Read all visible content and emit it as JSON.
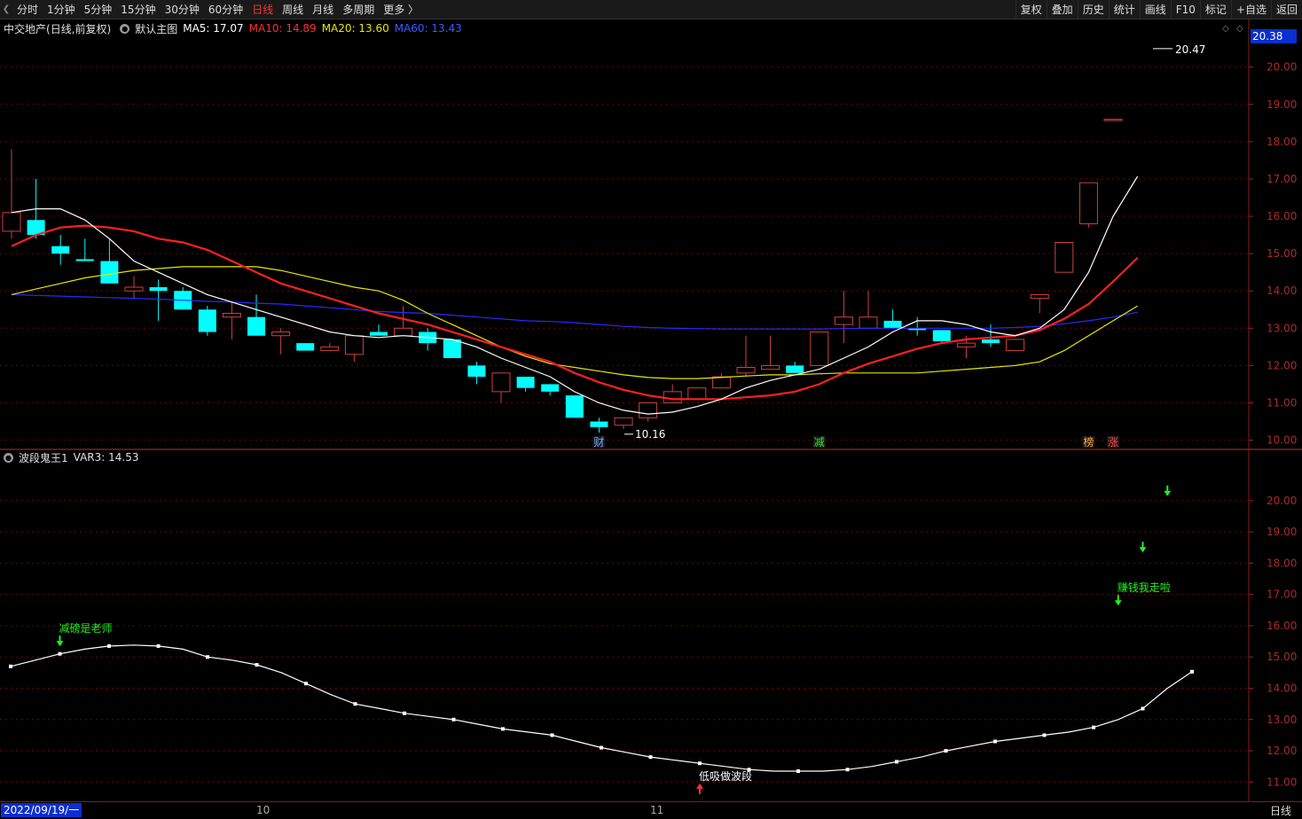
{
  "toolbar": {
    "tabs": [
      {
        "label": "分时",
        "active": false
      },
      {
        "label": "1分钟",
        "active": false
      },
      {
        "label": "5分钟",
        "active": false
      },
      {
        "label": "15分钟",
        "active": false
      },
      {
        "label": "30分钟",
        "active": false
      },
      {
        "label": "60分钟",
        "active": false
      },
      {
        "label": "日线",
        "active": true
      },
      {
        "label": "周线",
        "active": false
      },
      {
        "label": "月线",
        "active": false
      },
      {
        "label": "多周期",
        "active": false
      },
      {
        "label": "更多 〉",
        "active": false
      }
    ],
    "tools": [
      "复权",
      "叠加",
      "历史",
      "统计",
      "画线",
      "F10",
      "标记",
      "+自选",
      "返回"
    ]
  },
  "main_info": {
    "stock": "中交地产",
    "mode": "(日线,前复权)",
    "template": "默认主图",
    "ma5": "MA5: 17.07",
    "ma10": "MA10: 14.89",
    "ma20": "MA20: 13.60",
    "ma60": "MA60: 13.43",
    "current_price": "20.38",
    "high_label": "20.47",
    "low_label": "10.16"
  },
  "sub_info": {
    "indicator": "波段鬼王1",
    "var3": "VAR3: 14.53"
  },
  "bottom": {
    "date": "2022/09/19/一",
    "month_labels": [
      "10",
      "11"
    ],
    "period": "日线"
  },
  "colors": {
    "up": "#ff4040",
    "down": "#00ffff",
    "ma5": "#ffffff",
    "ma10": "#ff2020",
    "ma20": "#e8e800",
    "ma60": "#2a2aff",
    "grid": "#7a0000",
    "sig_text": "#22ee22"
  },
  "chart_data": [
    {
      "type": "candlestick",
      "y_ticks": [
        "20.00",
        "19.00",
        "18.00",
        "17.00",
        "16.00",
        "15.00",
        "14.00",
        "13.00",
        "12.00",
        "11.00",
        "10.00"
      ],
      "ylim": [
        9.8,
        20.8
      ],
      "candles": [
        {
          "o": 15.6,
          "c": 16.1,
          "h": 17.8,
          "l": 15.4
        },
        {
          "o": 15.9,
          "c": 15.5,
          "h": 17.0,
          "l": 15.4
        },
        {
          "o": 15.2,
          "c": 15.0,
          "h": 15.5,
          "l": 14.7
        },
        {
          "o": 14.85,
          "c": 14.8,
          "h": 15.4,
          "l": 14.8
        },
        {
          "o": 14.8,
          "c": 14.2,
          "h": 15.4,
          "l": 14.2
        },
        {
          "o": 14.0,
          "c": 14.1,
          "h": 14.4,
          "l": 13.8
        },
        {
          "o": 14.1,
          "c": 14.0,
          "h": 14.3,
          "l": 13.2
        },
        {
          "o": 14.0,
          "c": 13.5,
          "h": 14.1,
          "l": 13.5
        },
        {
          "o": 13.5,
          "c": 12.9,
          "h": 13.6,
          "l": 12.8
        },
        {
          "o": 13.3,
          "c": 13.4,
          "h": 13.7,
          "l": 12.7
        },
        {
          "o": 13.3,
          "c": 12.8,
          "h": 13.9,
          "l": 12.8
        },
        {
          "o": 12.8,
          "c": 12.9,
          "h": 13.0,
          "l": 12.3
        },
        {
          "o": 12.6,
          "c": 12.4,
          "h": 12.6,
          "l": 12.4
        },
        {
          "o": 12.4,
          "c": 12.5,
          "h": 12.6,
          "l": 12.4
        },
        {
          "o": 12.3,
          "c": 12.8,
          "h": 12.8,
          "l": 12.1
        },
        {
          "o": 12.9,
          "c": 12.8,
          "h": 13.1,
          "l": 12.8
        },
        {
          "o": 12.8,
          "c": 13.0,
          "h": 13.6,
          "l": 12.8
        },
        {
          "o": 12.9,
          "c": 12.6,
          "h": 13.0,
          "l": 12.4
        },
        {
          "o": 12.7,
          "c": 12.2,
          "h": 12.7,
          "l": 12.2
        },
        {
          "o": 12.0,
          "c": 11.7,
          "h": 12.1,
          "l": 11.5
        },
        {
          "o": 11.3,
          "c": 11.8,
          "h": 11.8,
          "l": 11.0
        },
        {
          "o": 11.7,
          "c": 11.4,
          "h": 11.7,
          "l": 11.3
        },
        {
          "o": 11.5,
          "c": 11.3,
          "h": 11.5,
          "l": 11.2
        },
        {
          "o": 11.2,
          "c": 10.6,
          "h": 11.2,
          "l": 10.6
        },
        {
          "o": 10.5,
          "c": 10.35,
          "h": 10.6,
          "l": 10.2
        },
        {
          "o": 10.4,
          "c": 10.6,
          "h": 10.6,
          "l": 10.3
        },
        {
          "o": 10.6,
          "c": 11.0,
          "h": 11.0,
          "l": 10.5
        },
        {
          "o": 11.0,
          "c": 11.3,
          "h": 11.5,
          "l": 11.0
        },
        {
          "o": 11.1,
          "c": 11.4,
          "h": 11.4,
          "l": 11.1
        },
        {
          "o": 11.4,
          "c": 11.7,
          "h": 11.8,
          "l": 11.4
        },
        {
          "o": 11.8,
          "c": 11.95,
          "h": 12.8,
          "l": 11.7
        },
        {
          "o": 11.9,
          "c": 12.0,
          "h": 12.8,
          "l": 11.9
        },
        {
          "o": 12.0,
          "c": 11.8,
          "h": 12.1,
          "l": 11.8
        },
        {
          "o": 12.0,
          "c": 12.9,
          "h": 12.9,
          "l": 12.0
        },
        {
          "o": 13.1,
          "c": 13.3,
          "h": 14.0,
          "l": 12.6
        },
        {
          "o": 13.0,
          "c": 13.3,
          "h": 14.0,
          "l": 13.0
        },
        {
          "o": 13.2,
          "c": 13.0,
          "h": 13.5,
          "l": 13.0
        },
        {
          "o": 13.0,
          "c": 12.95,
          "h": 13.3,
          "l": 12.8
        },
        {
          "o": 12.95,
          "c": 12.65,
          "h": 12.95,
          "l": 12.6
        },
        {
          "o": 12.5,
          "c": 12.6,
          "h": 12.8,
          "l": 12.2
        },
        {
          "o": 12.7,
          "c": 12.6,
          "h": 13.1,
          "l": 12.5
        },
        {
          "o": 12.4,
          "c": 12.7,
          "h": 12.7,
          "l": 12.4
        },
        {
          "o": 13.8,
          "c": 13.9,
          "h": 13.9,
          "l": 13.4
        },
        {
          "o": 14.5,
          "c": 15.3,
          "h": 15.3,
          "l": 14.5
        },
        {
          "o": 15.8,
          "c": 16.9,
          "h": 16.9,
          "l": 15.7
        },
        {
          "o": 18.6,
          "c": 18.6,
          "h": 18.6,
          "l": 18.6
        }
      ],
      "ma5": [
        16.1,
        16.2,
        16.2,
        15.9,
        15.4,
        14.8,
        14.5,
        14.2,
        13.9,
        13.7,
        13.5,
        13.3,
        13.1,
        12.9,
        12.8,
        12.75,
        12.8,
        12.75,
        12.7,
        12.5,
        12.2,
        11.95,
        11.7,
        11.3,
        11.0,
        10.8,
        10.7,
        10.75,
        10.9,
        11.1,
        11.4,
        11.6,
        11.75,
        11.9,
        12.2,
        12.5,
        12.9,
        13.2,
        13.2,
        13.1,
        12.9,
        12.8,
        13.0,
        13.5,
        14.5,
        16.0,
        17.07
      ],
      "ma10": [
        15.2,
        15.5,
        15.7,
        15.75,
        15.7,
        15.6,
        15.4,
        15.3,
        15.1,
        14.8,
        14.5,
        14.2,
        14.0,
        13.8,
        13.6,
        13.4,
        13.25,
        13.1,
        12.9,
        12.7,
        12.5,
        12.3,
        12.1,
        11.8,
        11.55,
        11.35,
        11.2,
        11.1,
        11.1,
        11.1,
        11.15,
        11.2,
        11.3,
        11.5,
        11.8,
        12.05,
        12.25,
        12.45,
        12.6,
        12.7,
        12.75,
        12.8,
        12.95,
        13.25,
        13.65,
        14.25,
        14.89
      ],
      "ma20": [
        13.9,
        14.05,
        14.2,
        14.35,
        14.45,
        14.55,
        14.6,
        14.65,
        14.65,
        14.65,
        14.65,
        14.55,
        14.4,
        14.25,
        14.1,
        14.0,
        13.75,
        13.4,
        13.1,
        12.8,
        12.5,
        12.25,
        12.05,
        11.95,
        11.85,
        11.75,
        11.68,
        11.65,
        11.65,
        11.68,
        11.72,
        11.75,
        11.75,
        11.78,
        11.8,
        11.8,
        11.8,
        11.8,
        11.85,
        11.9,
        11.95,
        12.0,
        12.1,
        12.4,
        12.8,
        13.2,
        13.6
      ],
      "ma60": [
        13.9,
        13.88,
        13.86,
        13.84,
        13.82,
        13.8,
        13.78,
        13.75,
        13.72,
        13.7,
        13.67,
        13.65,
        13.6,
        13.55,
        13.5,
        13.45,
        13.42,
        13.4,
        13.35,
        13.3,
        13.25,
        13.2,
        13.18,
        13.15,
        13.1,
        13.05,
        13.02,
        13.0,
        12.99,
        12.98,
        12.98,
        12.98,
        12.98,
        12.98,
        12.99,
        13.0,
        13.0,
        13.0,
        13.0,
        13.0,
        13.0,
        13.02,
        13.05,
        13.12,
        13.2,
        13.3,
        13.43
      ],
      "markers": [
        {
          "index": 24,
          "text": "财"
        },
        {
          "index": 33,
          "text": "减"
        },
        {
          "index": 44,
          "text": "榜"
        },
        {
          "index": 45,
          "text": "涨"
        }
      ]
    },
    {
      "type": "line",
      "y_ticks": [
        "20.00",
        "19.00",
        "18.00",
        "17.00",
        "16.00",
        "15.00",
        "14.00",
        "13.00",
        "12.00",
        "11.00"
      ],
      "ylim": [
        10.5,
        21.1
      ],
      "var3": [
        14.7,
        14.9,
        15.1,
        15.25,
        15.35,
        15.38,
        15.35,
        15.25,
        15.0,
        14.9,
        14.75,
        14.5,
        14.15,
        13.8,
        13.5,
        13.35,
        13.2,
        13.1,
        13.0,
        12.85,
        12.7,
        12.6,
        12.5,
        12.3,
        12.1,
        11.95,
        11.8,
        11.7,
        11.6,
        11.5,
        11.4,
        11.35,
        11.35,
        11.35,
        11.4,
        11.5,
        11.65,
        11.8,
        12.0,
        12.15,
        12.3,
        12.4,
        12.5,
        12.6,
        12.75,
        13.0,
        13.35,
        14.0,
        14.53
      ],
      "signals": [
        {
          "index": 2,
          "text": "减磅是老师",
          "dir": "down",
          "value": 15.4
        },
        {
          "index": 28,
          "text": "低吸做波段",
          "dir": "up",
          "value": 10.9
        },
        {
          "index": 45,
          "text": "赚钱我走啦",
          "dir": "down",
          "value": 16.7
        },
        {
          "index": 46,
          "text": "",
          "dir": "down",
          "value": 18.4
        },
        {
          "index": 47,
          "text": "",
          "dir": "down",
          "value": 20.2
        }
      ]
    }
  ]
}
